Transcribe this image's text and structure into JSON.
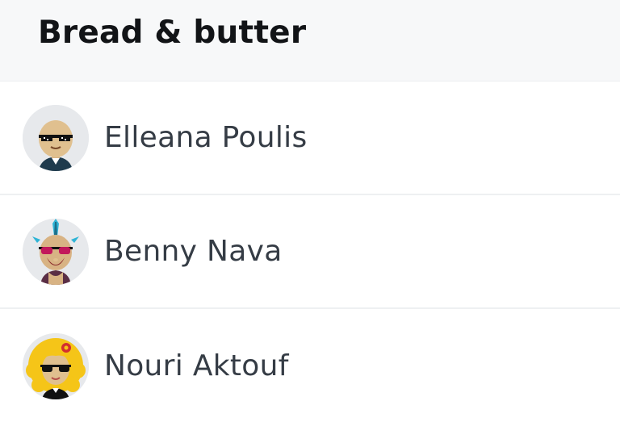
{
  "section": {
    "title": "Bread & butter"
  },
  "contacts": [
    {
      "name": "Elleana Poulis",
      "avatar_icon": "avatar-bald-sunglasses-icon"
    },
    {
      "name": "Benny Nava",
      "avatar_icon": "avatar-mohawk-sunglasses-icon"
    },
    {
      "name": "Nouri Aktouf",
      "avatar_icon": "avatar-blonde-flower-sunglasses-icon"
    }
  ],
  "colors": {
    "header_bg": "#f7f8f9",
    "divider": "#eef0f2",
    "name_text": "#353c45",
    "title_text": "#121417"
  }
}
